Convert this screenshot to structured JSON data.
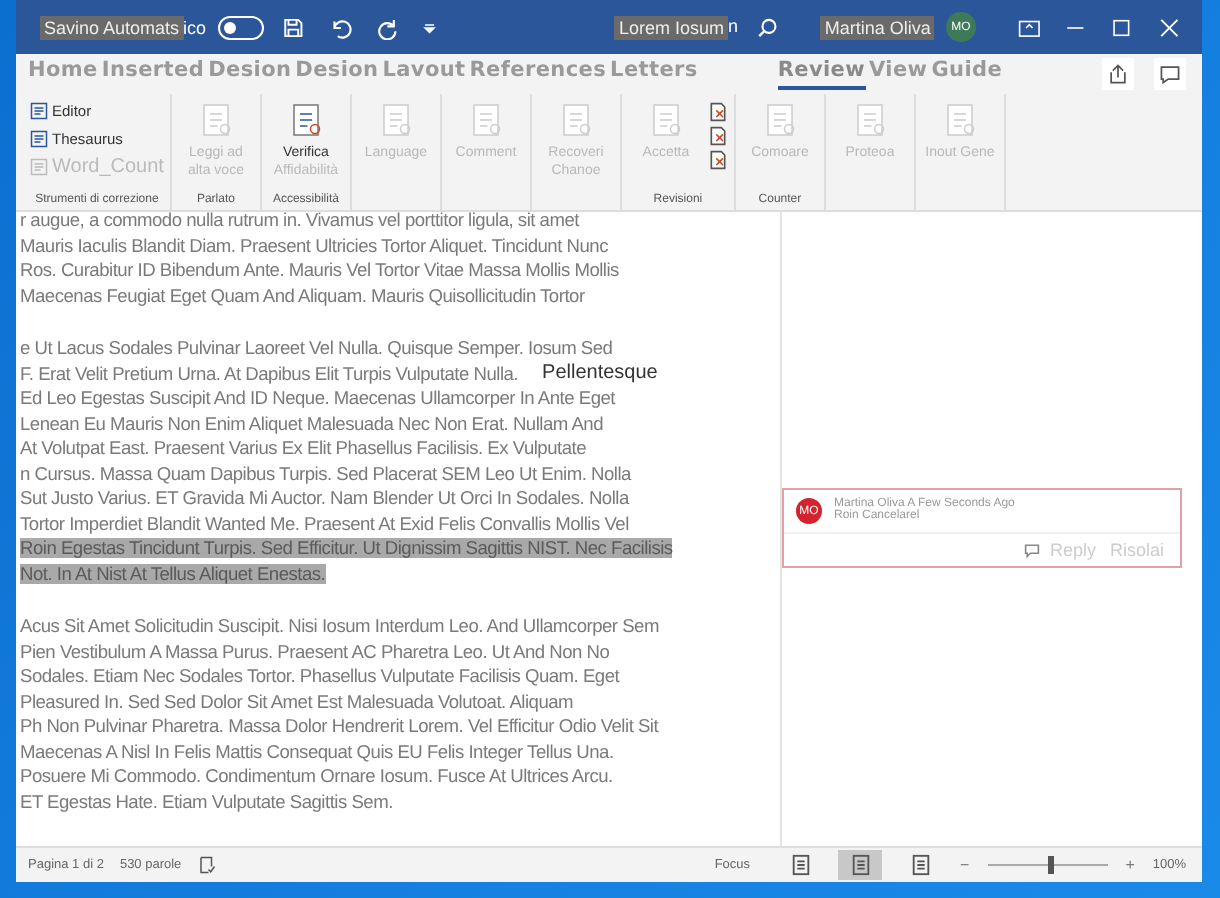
{
  "title_bar": {
    "autosave_label": "Savino Automats",
    "autosave_suffix": "ico",
    "autosave_on": false,
    "document_title": "Lorem Iosum",
    "title_suffix": "n",
    "user_name": "Martina Oliva",
    "avatar": "MO"
  },
  "tabs": [
    {
      "label": "Home",
      "selected": false
    },
    {
      "label": "Inserted",
      "selected": false
    },
    {
      "label": "Desion",
      "selected": false
    },
    {
      "label": "Desion",
      "selected": false
    },
    {
      "label": "Lavout",
      "selected": false
    },
    {
      "label": "References",
      "selected": false
    },
    {
      "label": "Letters",
      "selected": false
    },
    {
      "label": "Review",
      "selected": true
    },
    {
      "label": "View",
      "selected": false
    },
    {
      "label": "Guide",
      "selected": false
    }
  ],
  "ribbon": [
    {
      "label": "Strumenti di correzione",
      "items": [
        {
          "kind": "small",
          "label": "Editor",
          "disabled": false
        },
        {
          "kind": "small",
          "label": "Thesaurus",
          "disabled": false
        },
        {
          "kind": "small",
          "label": "Word_Count",
          "disabled": true
        }
      ]
    },
    {
      "label": "Parlato",
      "items": [
        {
          "kind": "large",
          "label": "Leggi ad alta voce",
          "disabled": true
        }
      ]
    },
    {
      "label": "Accessibilità",
      "items": [
        {
          "kind": "large",
          "label": "Verifica",
          "sublabel": "Affidabilità",
          "disabled": false
        }
      ]
    },
    {
      "items": [
        {
          "kind": "large",
          "label": "Language",
          "disabled": true
        }
      ]
    },
    {
      "items": [
        {
          "kind": "large",
          "label": "Comment",
          "disabled": true
        }
      ]
    },
    {
      "items": [
        {
          "kind": "large",
          "label": "Recoveri Chanoe",
          "disabled": true
        }
      ]
    },
    {
      "label": "Revisioni",
      "items": [
        {
          "kind": "large",
          "label": "Accetta",
          "disabled": true
        },
        {
          "kind": "stack"
        }
      ]
    },
    {
      "label": "Counter",
      "items": [
        {
          "kind": "large",
          "label": "Comoare",
          "disabled": true
        }
      ]
    },
    {
      "items": [
        {
          "kind": "large",
          "label": "Proteoa",
          "disabled": true
        }
      ]
    },
    {
      "items": [
        {
          "kind": "large",
          "label": "Inout Gene",
          "disabled": true
        }
      ]
    }
  ],
  "document": {
    "paragraphs": [
      {
        "lines": [
          {
            "text": "r augue, a commodo nulla rutrum in. Vivamus vel porttitor ligula, sit amet",
            "highlighted": false
          },
          {
            "text": "Mauris Iaculis Blandit Diam. Praesent Ultricies Tortor Aliquet. Tincidunt Nunc",
            "highlighted": false
          },
          {
            "text": "Ros. Curabitur ID Bibendum Ante. Mauris Vel Tortor Vitae Massa Mollis Mollis",
            "highlighted": false
          },
          {
            "text": "Maecenas Feugiat Eget Quam And Aliquam. Mauris Quisollicitudin Tortor",
            "highlighted": false
          }
        ]
      },
      {
        "lines": [
          {
            "text": "e Ut Lacus Sodales Pulvinar Laoreet Vel Nulla. Quisque Semper. Iosum Sed",
            "highlighted": false
          },
          {
            "text": "F. Erat Velit Pretium Urna. At Dapibus Elit Turpis Vulputate Nulla.",
            "aside": "Pellentesque",
            "highlighted": false
          },
          {
            "text": "Ed Leo Egestas Suscipit And ID Neque. Maecenas Ullamcorper In Ante Eget",
            "highlighted": false
          },
          {
            "text": "Lenean Eu Mauris Non Enim Aliquet Malesuada Nec Non Erat. Nullam And",
            "highlighted": false
          },
          {
            "text": "At Volutpat East. Praesent Varius Ex Elit Phasellus Facilisis. Ex Vulputate",
            "highlighted": false
          },
          {
            "text": "n Cursus. Massa Quam Dapibus Turpis. Sed Placerat SEM Leo Ut Enim. Nolla",
            "highlighted": false
          },
          {
            "text": "Sut Justo Varius. ET Gravida Mi Auctor. Nam Blender Ut Orci In Sodales. Nolla",
            "highlighted": false
          },
          {
            "text": "Tortor Imperdiet Blandit Wanted Me. Praesent At Exid Felis Convallis Mollis Vel",
            "highlighted": false
          },
          {
            "text": "Roin Egestas Tincidunt Turpis. Sed Efficitur. Ut Dignissim Sagittis NIST. Nec Facilisis",
            "highlighted": true
          },
          {
            "text": "Not. In At Nist At Tellus Aliquet Enestas.",
            "highlighted": true
          }
        ]
      },
      {
        "lines": [
          {
            "text": "Acus Sit Amet Solicitudin Suscipit. Nisi Iosum Interdum Leo. And Ullamcorper Sem",
            "highlighted": false
          },
          {
            "text": "Pien Vestibulum A Massa Purus. Praesent AC Pharetra Leo. Ut And Non No",
            "highlighted": false
          },
          {
            "text": "Sodales. Etiam Nec Sodales Tortor. Phasellus Vulputate Facilisis Quam. Eget",
            "highlighted": false
          },
          {
            "text": "Pleasured In. Sed Sed Dolor Sit Amet Est Malesuada Volutoat. Aliquam",
            "highlighted": false
          },
          {
            "text": "Ph Non Pulvinar Pharetra. Massa Dolor Hendrerit Lorem. Vel Efficitur Odio Velit Sit",
            "highlighted": false
          },
          {
            "text": "Maecenas A Nisl In Felis Mattis Consequat Quis EU Felis Integer Tellus Una.",
            "highlighted": false
          },
          {
            "text": "Posuere Mi Commodo. Condimentum Ornare Iosum. Fusce At Ultrices Arcu.",
            "highlighted": false
          },
          {
            "text": "ET Egestas Hate. Etiam Vulputate Sagittis Sem.",
            "highlighted": false
          }
        ]
      }
    ]
  },
  "comment": {
    "avatar": "MO",
    "header": "Martina Oliva A Few Seconds Ago",
    "text": "Roin Cancelarel",
    "reply": "Reply",
    "resolve": "Risolai"
  },
  "status_bar": {
    "page": "Pagina 1 di 2",
    "words": "530 parole",
    "focus": "Focus",
    "views": [
      {
        "selected": false
      },
      {
        "selected": true
      },
      {
        "selected": false
      }
    ],
    "zoom_out": "−",
    "level": 0.5,
    "zoom_in": "+",
    "zoom": "100%"
  }
}
